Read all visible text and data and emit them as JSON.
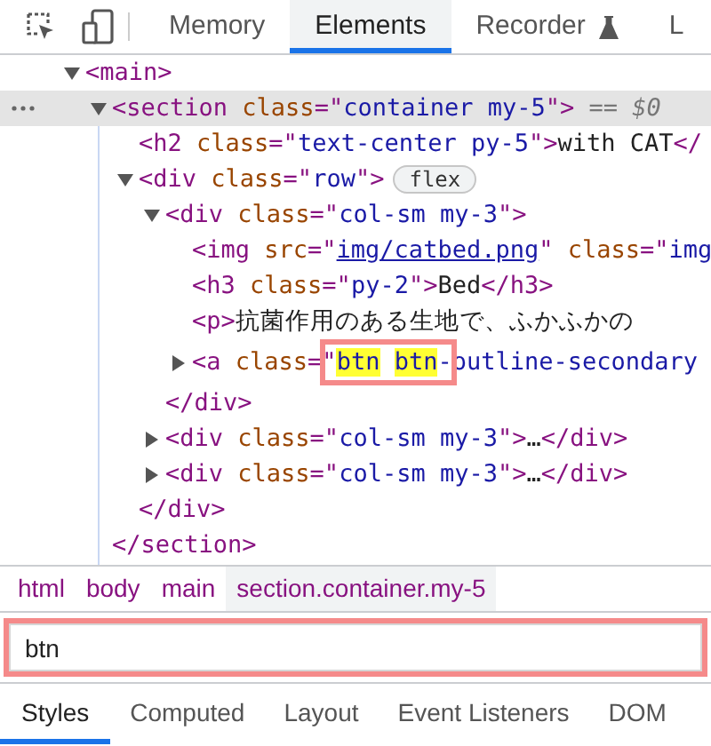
{
  "toolbar": {
    "tabs": [
      {
        "label": "Memory",
        "selected": false,
        "kind": "plain"
      },
      {
        "label": "Elements",
        "selected": true,
        "kind": "plain"
      },
      {
        "label": "Recorder",
        "selected": false,
        "kind": "flask"
      },
      {
        "label": "L",
        "selected": false,
        "kind": "plain"
      }
    ]
  },
  "dom_tree": [
    {
      "parts": [
        {
          "kind": "tag",
          "t": "<main>"
        }
      ],
      "expanded": true,
      "selected": false,
      "children": [
        {
          "parts": [
            {
              "kind": "tag",
              "t": "<section"
            },
            {
              "kind": "attr",
              "t": " class"
            },
            {
              "kind": "tag",
              "t": "=\""
            },
            {
              "kind": "value",
              "t": "container my-5"
            },
            {
              "kind": "tag",
              "t": "\">"
            },
            {
              "kind": "ref",
              "t": " == $0"
            }
          ],
          "expanded": true,
          "selected": true,
          "children": [
            {
              "parts": [
                {
                  "kind": "tag",
                  "t": "<h2"
                },
                {
                  "kind": "attr",
                  "t": " class"
                },
                {
                  "kind": "tag",
                  "t": "=\""
                },
                {
                  "kind": "value",
                  "t": "text-center py-5"
                },
                {
                  "kind": "tag",
                  "t": "\">"
                },
                {
                  "kind": "text",
                  "t": "with CAT"
                },
                {
                  "kind": "tag",
                  "t": "</"
                }
              ],
              "selected": false
            },
            {
              "parts": [
                {
                  "kind": "tag",
                  "t": "<div"
                },
                {
                  "kind": "attr",
                  "t": " class"
                },
                {
                  "kind": "tag",
                  "t": "=\""
                },
                {
                  "kind": "value",
                  "t": "row"
                },
                {
                  "kind": "tag",
                  "t": "\">"
                }
              ],
              "badge": "flex",
              "expanded": true,
              "selected": false,
              "children": [
                {
                  "parts": [
                    {
                      "kind": "tag",
                      "t": "<div"
                    },
                    {
                      "kind": "attr",
                      "t": " class"
                    },
                    {
                      "kind": "tag",
                      "t": "=\""
                    },
                    {
                      "kind": "value",
                      "t": "col-sm my-3"
                    },
                    {
                      "kind": "tag",
                      "t": "\">"
                    }
                  ],
                  "expanded": true,
                  "selected": false,
                  "children": [
                    {
                      "parts": [
                        {
                          "kind": "tag",
                          "t": "<img"
                        },
                        {
                          "kind": "attr",
                          "t": " src"
                        },
                        {
                          "kind": "tag",
                          "t": "=\""
                        },
                        {
                          "kind": "link",
                          "t": "img/catbed.png"
                        },
                        {
                          "kind": "tag",
                          "t": "\""
                        },
                        {
                          "kind": "attr",
                          "t": " class"
                        },
                        {
                          "kind": "tag",
                          "t": "=\""
                        },
                        {
                          "kind": "value",
                          "t": "img"
                        }
                      ],
                      "selected": false
                    },
                    {
                      "parts": [
                        {
                          "kind": "tag",
                          "t": "<h3"
                        },
                        {
                          "kind": "attr",
                          "t": " class"
                        },
                        {
                          "kind": "tag",
                          "t": "=\""
                        },
                        {
                          "kind": "value",
                          "t": "py-2"
                        },
                        {
                          "kind": "tag",
                          "t": "\">"
                        },
                        {
                          "kind": "text",
                          "t": "Bed"
                        },
                        {
                          "kind": "tag",
                          "t": "</h3>"
                        }
                      ],
                      "selected": false
                    },
                    {
                      "parts": [
                        {
                          "kind": "tag",
                          "t": "<p>"
                        },
                        {
                          "kind": "text",
                          "t": "抗菌作用のある生地で、ふかふかの"
                        }
                      ],
                      "selected": false
                    },
                    {
                      "parts": [
                        {
                          "kind": "tag",
                          "t": "<a"
                        },
                        {
                          "kind": "attr",
                          "t": " class"
                        },
                        {
                          "kind": "tag",
                          "t": "=\""
                        },
                        {
                          "kind": "match",
                          "t": "btn"
                        },
                        {
                          "kind": "gap"
                        },
                        {
                          "kind": "match",
                          "t": "btn"
                        },
                        {
                          "kind": "value",
                          "t": "-outline-secondary"
                        }
                      ],
                      "expanded": false,
                      "selected": false
                    }
                  ],
                  "closing": [
                    {
                      "kind": "tag",
                      "t": "</div>"
                    }
                  ]
                },
                {
                  "parts": [
                    {
                      "kind": "tag",
                      "t": "<div"
                    },
                    {
                      "kind": "attr",
                      "t": " class"
                    },
                    {
                      "kind": "tag",
                      "t": "=\""
                    },
                    {
                      "kind": "value",
                      "t": "col-sm my-3"
                    },
                    {
                      "kind": "tag",
                      "t": "\">"
                    },
                    {
                      "kind": "text",
                      "t": "…"
                    },
                    {
                      "kind": "tag",
                      "t": "</div>"
                    }
                  ],
                  "expanded": false,
                  "selected": false
                },
                {
                  "parts": [
                    {
                      "kind": "tag",
                      "t": "<div"
                    },
                    {
                      "kind": "attr",
                      "t": " class"
                    },
                    {
                      "kind": "tag",
                      "t": "=\""
                    },
                    {
                      "kind": "value",
                      "t": "col-sm my-3"
                    },
                    {
                      "kind": "tag",
                      "t": "\">"
                    },
                    {
                      "kind": "text",
                      "t": "…"
                    },
                    {
                      "kind": "tag",
                      "t": "</div>"
                    }
                  ],
                  "expanded": false,
                  "selected": false
                }
              ],
              "closing": [
                {
                  "kind": "tag",
                  "t": "</div>"
                }
              ]
            }
          ],
          "closing": [
            {
              "kind": "tag",
              "t": "</section>"
            }
          ]
        }
      ]
    }
  ],
  "breadcrumbs": [
    {
      "label": "html",
      "selected": false
    },
    {
      "label": "body",
      "selected": false
    },
    {
      "label": "main",
      "selected": false
    },
    {
      "label": "section.container.my-5",
      "selected": true
    }
  ],
  "search": {
    "value": "btn"
  },
  "panel_tabs": [
    {
      "label": "Styles",
      "selected": true
    },
    {
      "label": "Computed",
      "selected": false
    },
    {
      "label": "Layout",
      "selected": false
    },
    {
      "label": "Event Listeners",
      "selected": false
    },
    {
      "label": "DOM",
      "selected": false
    }
  ]
}
